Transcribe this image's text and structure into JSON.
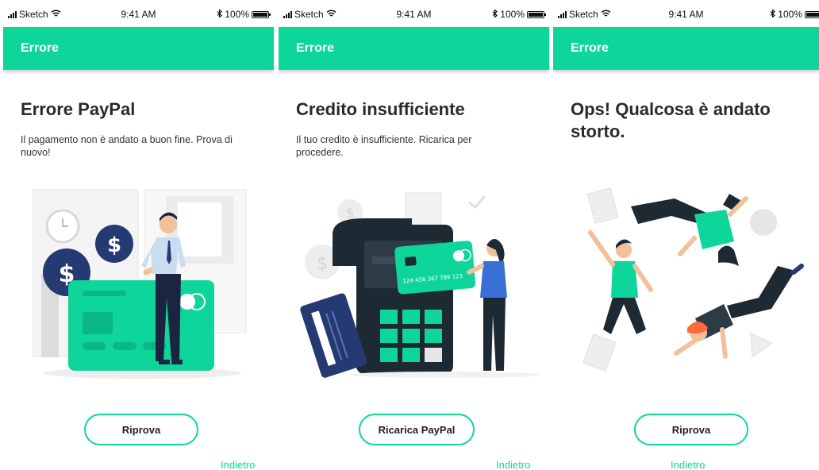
{
  "status_bar": {
    "carrier": "Sketch",
    "time": "9:41 AM",
    "battery": "100%"
  },
  "screens": [
    {
      "appbar_title": "Errore",
      "title": "Errore PayPal",
      "description": "Il pagamento non è andato a buon fine. Prova di nuovo!",
      "button_label": "Riprova",
      "back_link": "Indietro",
      "illustration": "man-with-credit-card"
    },
    {
      "appbar_title": "Errore",
      "title": "Credito insufficiente",
      "description": "Il tuo credito è insufficiente. Ricarica per procedere.",
      "button_label": "Ricarica PayPal",
      "back_link": "Indietro",
      "illustration": "woman-at-pos-terminal",
      "card_number": "124 456 367 789 123"
    },
    {
      "appbar_title": "Errore",
      "title": "Ops! Qualcosa è andato storto.",
      "description": "",
      "button_label": "Riprova",
      "back_link": "Indietro",
      "illustration": "people-falling"
    }
  ],
  "colors": {
    "accent": "#0ed59a",
    "navy": "#253a73",
    "dark": "#1e2a33"
  }
}
